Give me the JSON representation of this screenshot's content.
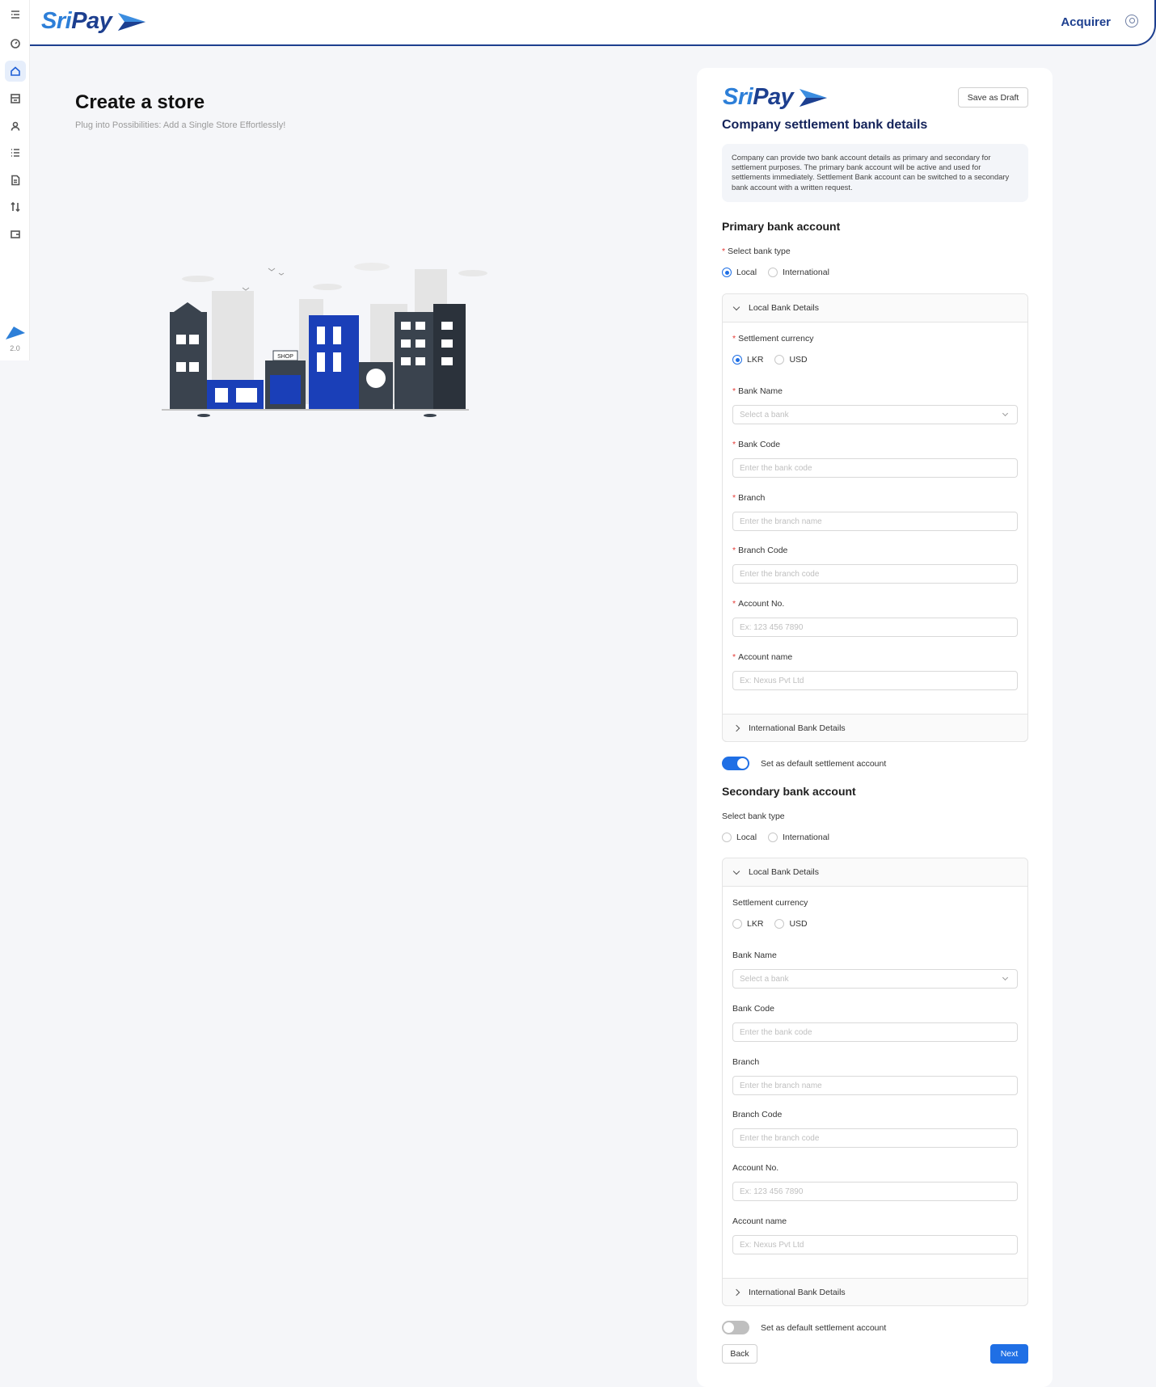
{
  "header": {
    "brand_sri": "Sri",
    "brand_pay": "Pay",
    "user_name": "Acquirer"
  },
  "sidebar": {
    "icons": [
      "menu-icon",
      "dashboard-icon",
      "home-icon",
      "store-icon",
      "user-icon",
      "list-icon",
      "document-icon",
      "transfer-icon",
      "wallet-icon"
    ],
    "active": "home-icon",
    "version": "2.0"
  },
  "page": {
    "title": "Create a store",
    "subtitle": "Plug into Possibilities: Add a Single Store Effortlessly!",
    "illustration_sign": "SHOP"
  },
  "card": {
    "brand_sri": "Sri",
    "brand_pay": "Pay",
    "save_draft": "Save as Draft",
    "title": "Company settlement bank details",
    "info": "Company can provide two bank account details as primary and secondary for settlement purposes. The primary bank account will be active and used for settlements immediately. Settlement Bank account can be switched to a secondary bank account with a written request.",
    "primary": {
      "title": "Primary bank account",
      "bank_type_label": "Select bank type",
      "opt_local": "Local",
      "opt_international": "International",
      "local_header": "Local Bank Details",
      "currency_label": "Settlement currency",
      "opt_lkr": "LKR",
      "opt_usd": "USD",
      "bank_name_label": "Bank Name",
      "bank_name_placeholder": "Select a bank",
      "bank_code_label": "Bank Code",
      "bank_code_placeholder": "Enter the bank code",
      "branch_label": "Branch",
      "branch_placeholder": "Enter the branch name",
      "branch_code_label": "Branch Code",
      "branch_code_placeholder": "Enter the branch code",
      "account_no_label": "Account No.",
      "account_no_placeholder": "Ex: 123 456 7890",
      "account_name_label": "Account name",
      "account_name_placeholder": "Ex: Nexus Pvt Ltd",
      "intl_header": "International Bank Details",
      "default_toggle": "Set as default settlement account"
    },
    "secondary": {
      "title": "Secondary bank account",
      "bank_type_label": "Select bank type",
      "opt_local": "Local",
      "opt_international": "International",
      "local_header": "Local Bank Details",
      "currency_label": "Settlement currency",
      "opt_lkr": "LKR",
      "opt_usd": "USD",
      "bank_name_label": "Bank Name",
      "bank_name_placeholder": "Select a bank",
      "bank_code_label": "Bank Code",
      "bank_code_placeholder": "Enter the bank code",
      "branch_label": "Branch",
      "branch_placeholder": "Enter the branch name",
      "branch_code_label": "Branch Code",
      "branch_code_placeholder": "Enter the branch code",
      "account_no_label": "Account No.",
      "account_no_placeholder": "Ex: 123 456 7890",
      "account_name_label": "Account name",
      "account_name_placeholder": "Ex: Nexus Pvt Ltd",
      "intl_header": "International Bank Details",
      "default_toggle": "Set as default settlement account"
    },
    "back": "Back",
    "next": "Next"
  },
  "colors": {
    "brand_blue": "#1d3f8f",
    "brand_light": "#2d7fd8",
    "primary": "#1f6fe5",
    "required": "#e53935"
  }
}
